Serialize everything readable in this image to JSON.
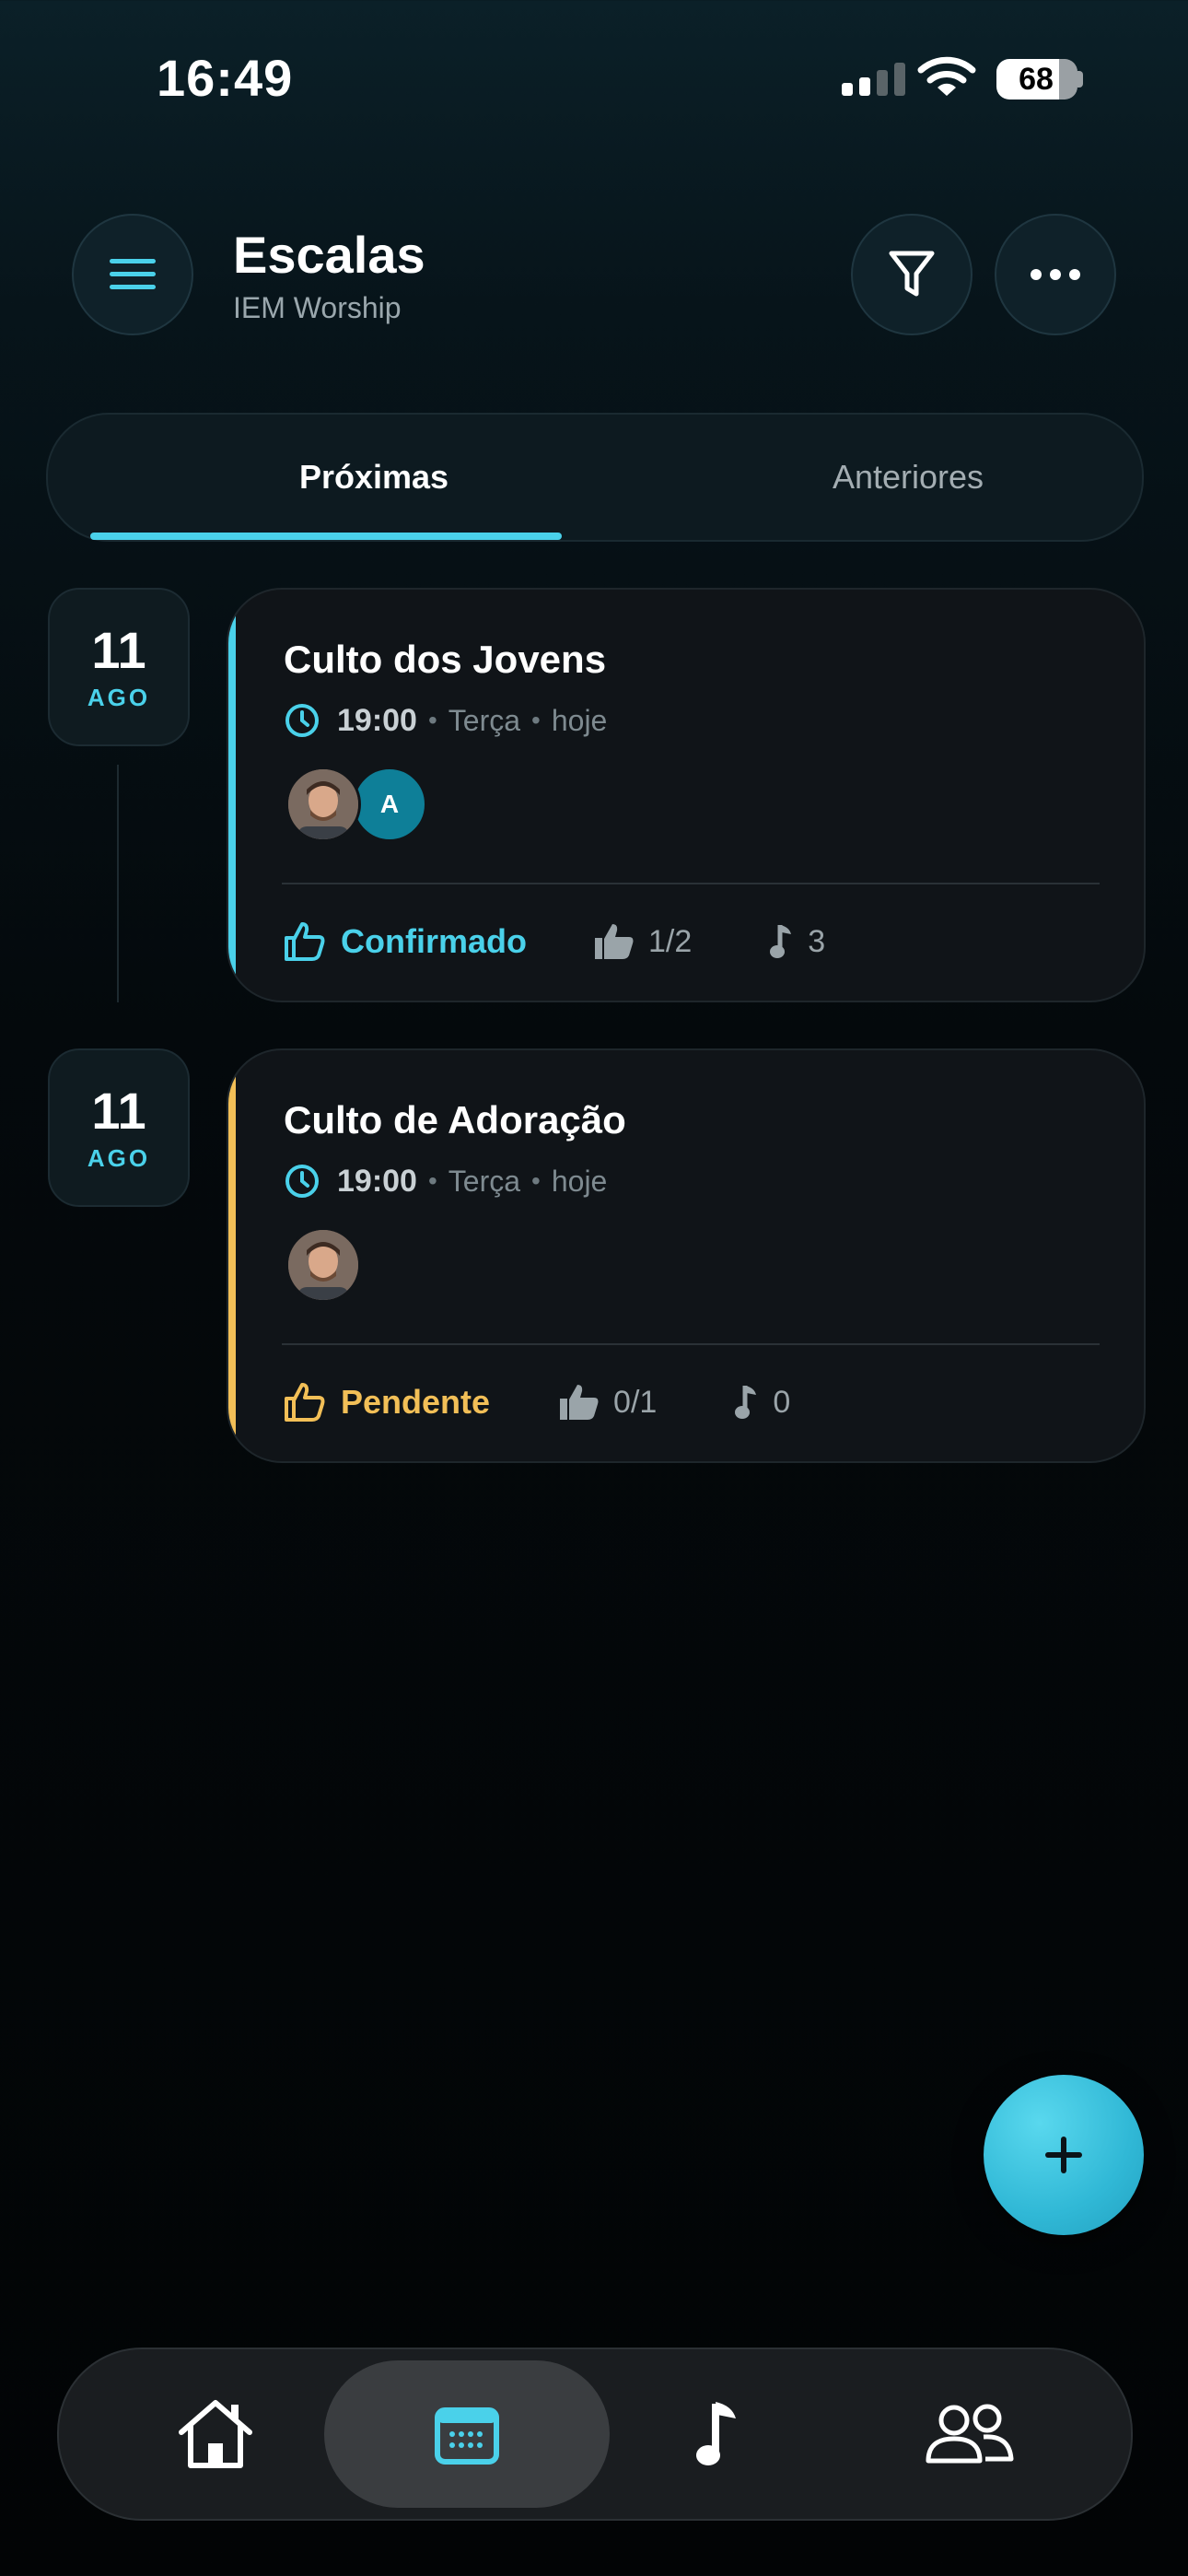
{
  "status_bar": {
    "time": "16:49",
    "battery": "68"
  },
  "header": {
    "title": "Escalas",
    "subtitle": "IEM Worship"
  },
  "tabs": [
    {
      "label": "Próximas",
      "active": true
    },
    {
      "label": "Anteriores",
      "active": false
    }
  ],
  "events": [
    {
      "day": "11",
      "month": "AGO",
      "title": "Culto dos Jovens",
      "time": "19:00",
      "weekday": "Terça",
      "when": "hoje",
      "avatar_letter": "A",
      "status": "Confirmado",
      "status_color": "#4ad1ea",
      "confirmations": "1/2",
      "songs": "3"
    },
    {
      "day": "11",
      "month": "AGO",
      "title": "Culto de Adoração",
      "time": "19:00",
      "weekday": "Terça",
      "when": "hoje",
      "status": "Pendente",
      "status_color": "#f2bf57",
      "confirmations": "0/1",
      "songs": "0"
    }
  ],
  "fab": {
    "icon": "plus-icon"
  },
  "bottom_nav": [
    {
      "icon": "home-icon",
      "active": false
    },
    {
      "icon": "calendar-icon",
      "active": true
    },
    {
      "icon": "music-note-icon",
      "active": false
    },
    {
      "icon": "people-icon",
      "active": false
    }
  ]
}
